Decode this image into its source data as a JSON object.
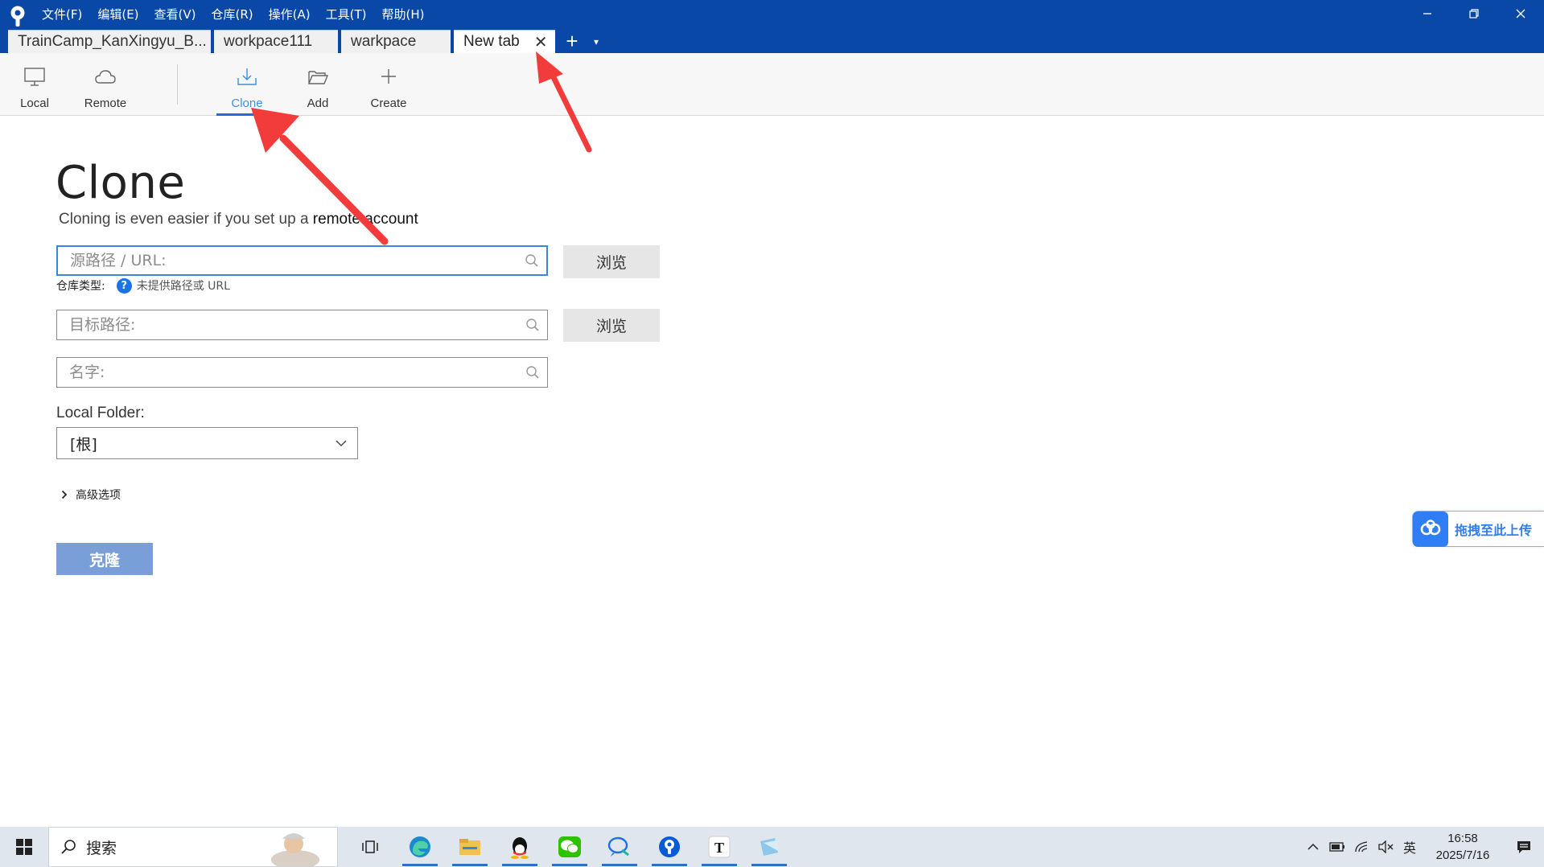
{
  "titlebar": {
    "menu": [
      "文件(F)",
      "编辑(E)",
      "查看(V)",
      "仓库(R)",
      "操作(A)",
      "工具(T)",
      "帮助(H)"
    ],
    "window_controls": [
      "minimize-icon",
      "restore-icon",
      "close-icon"
    ],
    "tabs": [
      {
        "label": "TrainCamp_KanXingyu_B..."
      },
      {
        "label": "workpace111"
      },
      {
        "label": "warkpace"
      },
      {
        "label": "New tab"
      }
    ],
    "tab_close": "✕",
    "tab_add": "+",
    "tab_dropdown": "▾"
  },
  "toolbar": {
    "local": "Local",
    "remote": "Remote",
    "clone": "Clone",
    "add": "Add",
    "create": "Create",
    "active": "Clone"
  },
  "clone_form": {
    "title": "Clone",
    "subtitle_prefix": "Cloning is even easier if you set up a ",
    "subtitle_link": "remote account",
    "source_placeholder": "源路径 / URL:",
    "repo_type_label": "仓库类型:",
    "repo_type_help": "?",
    "repo_type_value": "未提供路径或 URL",
    "target_placeholder": "目标路径:",
    "name_placeholder": "名字:",
    "browse_1": "浏览",
    "browse_2": "浏览",
    "local_folder_label": "Local Folder:",
    "local_folder_value": "[根]",
    "advanced_label": "高级选项",
    "clone_button": "克隆"
  },
  "upload_widget": {
    "label": "拖拽至此上传"
  },
  "taskbar": {
    "search_text": "搜索",
    "apps": [
      "task-view-icon",
      "edge-icon",
      "file-explorer-icon",
      "qq-icon",
      "wechat-icon",
      "chat-search-icon",
      "sourcetree-icon",
      "typora-icon",
      "notes-icon"
    ],
    "tray_lang": "英",
    "time": "16:58",
    "date": "2025/7/16"
  }
}
